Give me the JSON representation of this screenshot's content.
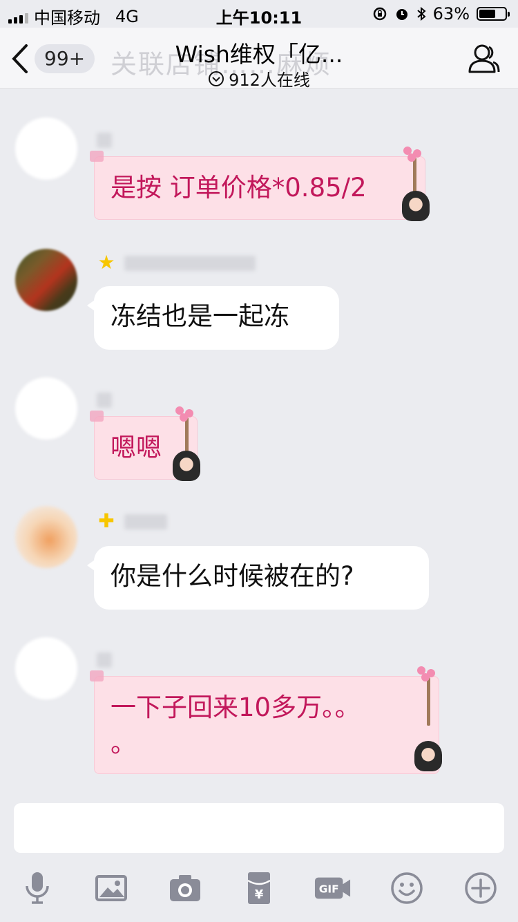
{
  "status_bar": {
    "carrier": "中国移动",
    "network": "4G",
    "time": "上午10:11",
    "battery_percent": "63%",
    "battery_level": 0.63
  },
  "nav": {
    "back_badge": "99+",
    "title": "Wish维权「亿...",
    "online_count": "912人在线",
    "ghost_text": "关联店铺……麻烦"
  },
  "messages": [
    {
      "text": "是按 订单价格*0.85/2",
      "style": "pink"
    },
    {
      "text": "冻结也是一起冻",
      "style": "white"
    },
    {
      "text": "嗯嗯",
      "style": "pink"
    },
    {
      "text": "你是什么时候被在的?",
      "style": "white"
    },
    {
      "text": "一下子回来10多万。。",
      "text_line2": "。",
      "style": "pink"
    }
  ],
  "input": {
    "value": ""
  },
  "toolbar": {
    "icons": [
      "microphone-icon",
      "image-icon",
      "camera-icon",
      "red-packet-icon",
      "gif-icon",
      "emoji-icon",
      "plus-icon"
    ]
  },
  "colors": {
    "pink_text": "#c2185b",
    "pink_bubble": "#fde0e7",
    "bg": "#ebecf0"
  }
}
